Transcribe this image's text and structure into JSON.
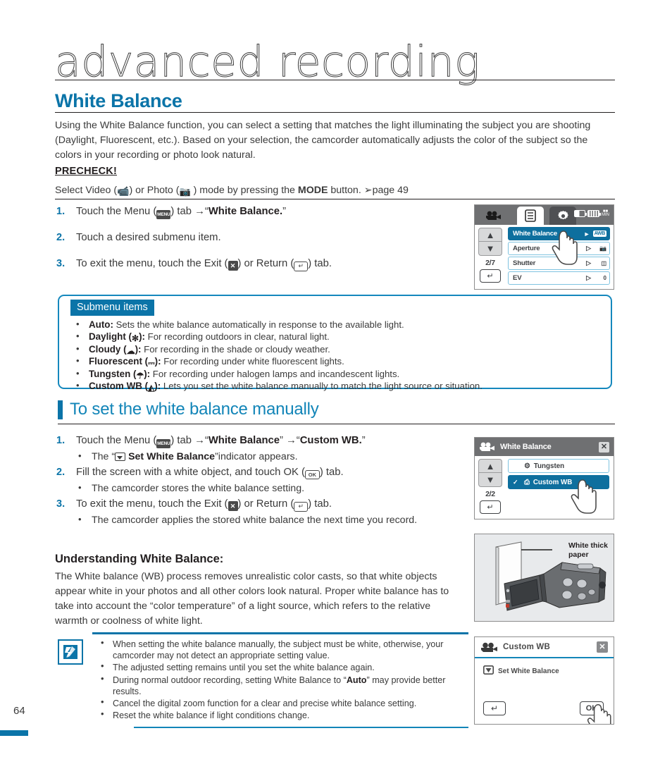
{
  "chapter": {
    "title": "advanced recording"
  },
  "section": {
    "title": "White Balance"
  },
  "intro": "Using the White Balance function, you can select a setting that matches the light illuminating the subject you are shooting (Daylight, Fluorescent, etc.). Based on your selection, the camcorder automatically adjusts the color of the subject so the colors in your recording or photo look natural.",
  "precheck": {
    "label": "PRECHECK!",
    "text_1": "Select Video (",
    "text_2": ") or Photo (",
    "text_3": " ) mode by pressing the ",
    "mode_bold": "MODE",
    "text_4": " button. ",
    "page_ref": "page 49"
  },
  "steps": [
    {
      "num": "1.",
      "pre": "Touch the Menu (",
      "icon": "MENU",
      "mid": ") tab ",
      "arrow": "→",
      "quote_open": "“",
      "bold": "White Balance.",
      "quote_close": "”"
    },
    {
      "num": "2.",
      "text": "Touch a desired submenu item."
    },
    {
      "num": "3.",
      "pre": "To exit the menu, touch the Exit (",
      "mid": ") or Return (",
      "post": ") tab."
    }
  ],
  "submenu": {
    "tag": "Submenu items",
    "items": [
      {
        "name": "Auto:",
        "icon": "",
        "desc": " Sets the white balance automatically in response to the available light."
      },
      {
        "name": "Daylight",
        "icon": "✻",
        "desc": " For recording outdoors in clear, natural light."
      },
      {
        "name": "Cloudy",
        "icon": "☁",
        "desc": " For recording in the shade or cloudy weather."
      },
      {
        "name": "Fluorescent",
        "icon": "⎓",
        "desc": " For recording under white fluorescent lights."
      },
      {
        "name": "Tungsten",
        "icon": "☂",
        "desc": " For recording under halogen lamps and incandescent lights."
      },
      {
        "name": "Custom WB",
        "icon": "◭",
        "desc": " Lets you set the white balance manually to match the light source or situation."
      }
    ]
  },
  "subsection": {
    "title": "To set the white balance manually"
  },
  "manual_steps": {
    "s1_pre": "Touch the Menu (",
    "s1_mid": ") tab ",
    "s1_b1": "White Balance",
    "s1_b2": "Custom WB.",
    "s1_sub_pre": "The “",
    "s1_sub_bold": "Set White Balance",
    "s1_sub_post": "”indicator appears.",
    "s2_pre": "Fill the screen with a white object, and touch OK (",
    "s2_post": ") tab.",
    "s2_sub": "The camcorder stores the white balance setting.",
    "s3_pre": "To exit the menu, touch the Exit (",
    "s3_mid": ") or Return (",
    "s3_post": ") tab.",
    "s3_sub": "The camcorder applies the stored white balance the next time you record.",
    "n1": "1.",
    "n2": "2.",
    "n3": "3."
  },
  "understanding": {
    "heading": "Understanding White Balance:",
    "text": "The White balance (WB) process removes unrealistic color casts, so that white objects appear white in your photos and all other colors look natural. Proper white balance has to take into account the “color temperature” of a light source, which refers to the relative warmth or coolness of white light."
  },
  "notes": [
    {
      "pre": "When setting the white balance manually, the subject must be white, otherwise, your camcorder may not detect an appropriate setting value.",
      "bold": "",
      "post": ""
    },
    {
      "pre": "The adjusted setting remains until you set the white balance again.",
      "bold": "",
      "post": ""
    },
    {
      "pre": "During normal outdoor recording, setting White Balance to “",
      "bold": "Auto",
      "post": "” may provide better results."
    },
    {
      "pre": "Cancel the digital zoom function for a clear and precise white balance setting.",
      "bold": "",
      "post": ""
    },
    {
      "pre": "Reset the white balance if light conditions change.",
      "bold": "",
      "post": ""
    }
  ],
  "page_number": "64",
  "lcd_menu": {
    "page_indicator": "2/7",
    "rows": [
      {
        "label": "White Balance",
        "value": "AWB",
        "selected": true
      },
      {
        "label": "Aperture",
        "value": "",
        "selected": false
      },
      {
        "label": "Shutter",
        "value": "",
        "selected": false
      },
      {
        "label": "EV",
        "value": "0",
        "selected": false
      }
    ]
  },
  "lcd_wb": {
    "title": "White Balance",
    "page_indicator": "2/2",
    "close": "✕",
    "rows": [
      {
        "label": "Tungsten",
        "selected": false,
        "check": ""
      },
      {
        "label": "Custom WB",
        "selected": true,
        "check": "✓"
      }
    ]
  },
  "photo_panel": {
    "label_line1": "White thick",
    "label_line2": "paper"
  },
  "lcd_custom": {
    "title": "Custom WB",
    "item": "Set White Balance",
    "ok": "OK",
    "close": "✕"
  },
  "colors": {
    "accent_blue": "#0b74a8",
    "light_blue": "#1285b8",
    "lcd_selected": "#0e6f9e",
    "lcd_topbar": "#6f7072",
    "text": "#3a3a3a"
  }
}
